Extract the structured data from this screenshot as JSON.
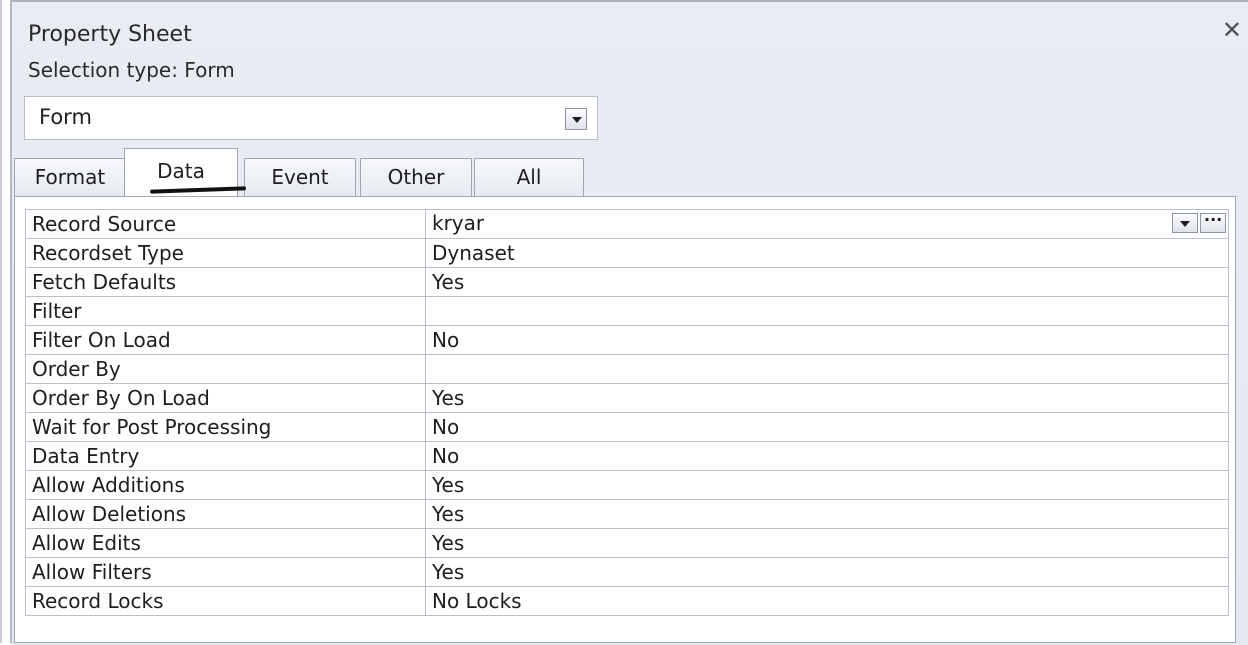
{
  "panel": {
    "title": "Property Sheet",
    "close_glyph": "✕",
    "selection_type": "Selection type:  Form"
  },
  "object_selector": {
    "value": "Form"
  },
  "tabs": [
    {
      "label": "Format"
    },
    {
      "label": "Data"
    },
    {
      "label": "Event"
    },
    {
      "label": "Other"
    },
    {
      "label": "All"
    }
  ],
  "active_tab": "Data",
  "properties": [
    {
      "name": "Record Source",
      "value": "kryar"
    },
    {
      "name": "Recordset Type",
      "value": "Dynaset"
    },
    {
      "name": "Fetch Defaults",
      "value": "Yes"
    },
    {
      "name": "Filter",
      "value": ""
    },
    {
      "name": "Filter On Load",
      "value": "No"
    },
    {
      "name": "Order By",
      "value": ""
    },
    {
      "name": "Order By On Load",
      "value": "Yes"
    },
    {
      "name": "Wait for Post Processing",
      "value": "No"
    },
    {
      "name": "Data Entry",
      "value": "No"
    },
    {
      "name": "Allow Additions",
      "value": "Yes"
    },
    {
      "name": "Allow Deletions",
      "value": "Yes"
    },
    {
      "name": "Allow Edits",
      "value": "Yes"
    },
    {
      "name": "Allow Filters",
      "value": "Yes"
    },
    {
      "name": "Record Locks",
      "value": "No Locks"
    }
  ]
}
